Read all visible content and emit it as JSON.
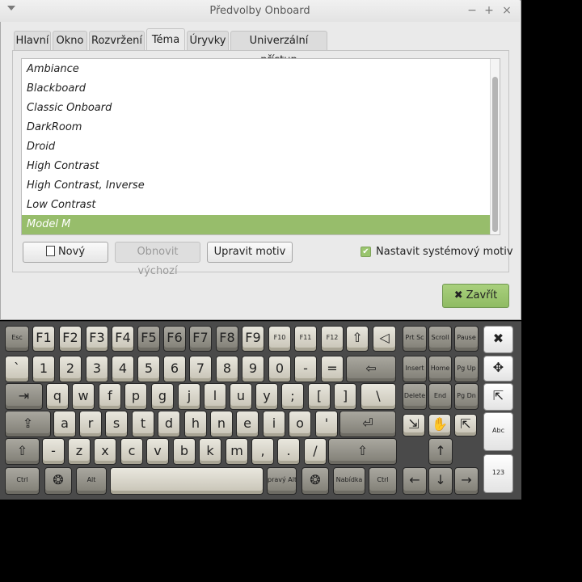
{
  "window": {
    "title": "Předvolby Onboard"
  },
  "tabs": [
    {
      "label": "Hlavní"
    },
    {
      "label": "Okno"
    },
    {
      "label": "Rozvržení"
    },
    {
      "label": "Téma"
    },
    {
      "label": "Úryvky"
    },
    {
      "label": "Univerzální přístup"
    }
  ],
  "active_tab": "Téma",
  "themes": [
    {
      "label": "Ambiance"
    },
    {
      "label": "Blackboard"
    },
    {
      "label": "Classic Onboard"
    },
    {
      "label": "DarkRoom"
    },
    {
      "label": "Droid"
    },
    {
      "label": "High Contrast"
    },
    {
      "label": "High Contrast, Inverse"
    },
    {
      "label": "Low Contrast"
    },
    {
      "label": "Model M"
    }
  ],
  "selected_theme": "Model M",
  "buttons": {
    "new": "Nový",
    "reset": "Obnovit výchozí",
    "edit": "Upravit motiv",
    "close": "Zavřít"
  },
  "checkbox": {
    "label": "Nastavit systémový motiv",
    "checked": true
  },
  "colors": {
    "accent": "#97bd6b",
    "key_light": "#dcd9ce",
    "key_dark": "#918f86"
  },
  "keyboard": {
    "rows": [
      [
        {
          "l": "Esc",
          "t": "d"
        },
        {
          "l": "F1",
          "t": "g"
        },
        {
          "l": "F2",
          "t": "g"
        },
        {
          "l": "F3",
          "t": "g"
        },
        {
          "l": "F4",
          "t": "g"
        },
        {
          "l": "F5",
          "t": "d"
        },
        {
          "l": "F6",
          "t": "d"
        },
        {
          "l": "F7",
          "t": "d"
        },
        {
          "l": "F8",
          "t": "d"
        },
        {
          "l": "F9",
          "t": "g"
        },
        {
          "l": "F10",
          "t": "g"
        },
        {
          "l": "F11",
          "t": "g"
        },
        {
          "l": "F12",
          "t": "g"
        },
        {
          "l": "⇧",
          "t": "g"
        },
        {
          "l": "◁",
          "t": "g"
        },
        {
          "l": "Prt Sc",
          "t": "d"
        },
        {
          "l": "Scroll",
          "t": "d"
        },
        {
          "l": "Pause",
          "t": "d"
        }
      ],
      [
        {
          "l": "`",
          "t": "g"
        },
        {
          "l": "1",
          "t": "g"
        },
        {
          "l": "2",
          "t": "g"
        },
        {
          "l": "3",
          "t": "g"
        },
        {
          "l": "4",
          "t": "g"
        },
        {
          "l": "5",
          "t": "g"
        },
        {
          "l": "6",
          "t": "g"
        },
        {
          "l": "7",
          "t": "g"
        },
        {
          "l": "8",
          "t": "g"
        },
        {
          "l": "9",
          "t": "g"
        },
        {
          "l": "0",
          "t": "g"
        },
        {
          "l": "-",
          "t": "g"
        },
        {
          "l": "=",
          "t": "g"
        },
        {
          "l": "⇦",
          "t": "d"
        },
        {
          "l": "Insert",
          "t": "d"
        },
        {
          "l": "Home",
          "t": "d"
        },
        {
          "l": "Pg Up",
          "t": "d"
        }
      ],
      [
        {
          "l": "⇥",
          "t": "d"
        },
        {
          "l": "q",
          "t": "g"
        },
        {
          "l": "w",
          "t": "g"
        },
        {
          "l": "f",
          "t": "g"
        },
        {
          "l": "p",
          "t": "g"
        },
        {
          "l": "g",
          "t": "g"
        },
        {
          "l": "j",
          "t": "g"
        },
        {
          "l": "l",
          "t": "g"
        },
        {
          "l": "u",
          "t": "g"
        },
        {
          "l": "y",
          "t": "g"
        },
        {
          "l": ";",
          "t": "g"
        },
        {
          "l": "[",
          "t": "g"
        },
        {
          "l": "]",
          "t": "g"
        },
        {
          "l": "\\",
          "t": "g"
        },
        {
          "l": "Delete",
          "t": "d"
        },
        {
          "l": "End",
          "t": "d"
        },
        {
          "l": "Pg Dn",
          "t": "d"
        }
      ],
      [
        {
          "l": "⇪",
          "t": "d"
        },
        {
          "l": "a",
          "t": "g"
        },
        {
          "l": "r",
          "t": "g"
        },
        {
          "l": "s",
          "t": "g"
        },
        {
          "l": "t",
          "t": "g"
        },
        {
          "l": "d",
          "t": "g"
        },
        {
          "l": "h",
          "t": "g"
        },
        {
          "l": "n",
          "t": "g"
        },
        {
          "l": "e",
          "t": "g"
        },
        {
          "l": "i",
          "t": "g"
        },
        {
          "l": "o",
          "t": "g"
        },
        {
          "l": "'",
          "t": "g"
        },
        {
          "l": "⏎",
          "t": "d"
        }
      ],
      [
        {
          "l": "⇧",
          "t": "d"
        },
        {
          "l": "-",
          "t": "g"
        },
        {
          "l": "z",
          "t": "g"
        },
        {
          "l": "x",
          "t": "g"
        },
        {
          "l": "c",
          "t": "g"
        },
        {
          "l": "v",
          "t": "g"
        },
        {
          "l": "b",
          "t": "g"
        },
        {
          "l": "k",
          "t": "g"
        },
        {
          "l": "m",
          "t": "g"
        },
        {
          "l": ",",
          "t": "g"
        },
        {
          "l": ".",
          "t": "g"
        },
        {
          "l": "/",
          "t": "g"
        },
        {
          "l": "⇧",
          "t": "d"
        },
        {
          "l": "↑",
          "t": "d"
        }
      ],
      [
        {
          "l": "Ctrl",
          "t": "d"
        },
        {
          "l": "❂",
          "t": "d"
        },
        {
          "l": "Alt",
          "t": "d"
        },
        {
          "l": "",
          "t": "g"
        },
        {
          "l": "pravý Alt",
          "t": "d"
        },
        {
          "l": "❂",
          "t": "d"
        },
        {
          "l": "Nabídka",
          "t": "d"
        },
        {
          "l": "Ctrl",
          "t": "d"
        },
        {
          "l": "←",
          "t": "d"
        },
        {
          "l": "↓",
          "t": "d"
        },
        {
          "l": "→",
          "t": "d"
        }
      ]
    ],
    "side": [
      {
        "l": "✖"
      },
      {
        "l": "✥"
      },
      {
        "l": "⇱"
      },
      {
        "l": "Abc"
      },
      {
        "l": "123"
      }
    ],
    "mouse": [
      {
        "l": "⇲"
      },
      {
        "l": "✋"
      },
      {
        "l": "⇱"
      }
    ]
  }
}
